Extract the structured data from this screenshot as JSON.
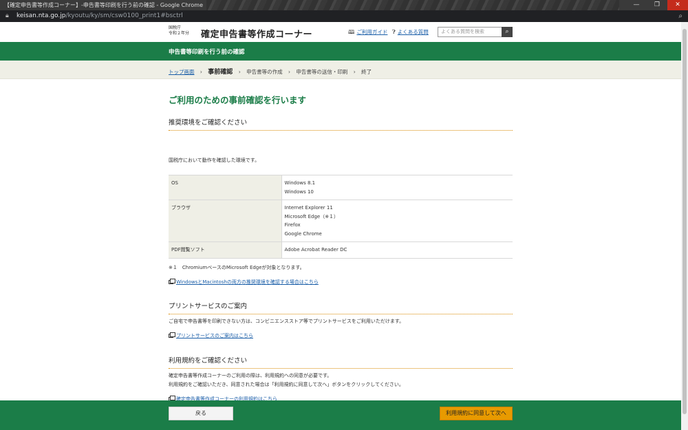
{
  "browser": {
    "window_title": "【確定申告書等作成コーナー】-申告書等印刷を行う前の確認 - Google Chrome",
    "url_host": "keisan.nta.go.jp",
    "url_path": "/kyoutu/ky/sm/csw0100_print1#bsctrl",
    "minimize": "—",
    "restore": "❐",
    "close": "✕"
  },
  "header": {
    "agency": "国税庁",
    "year": "令和２年分",
    "title": "確定申告書等作成コーナー",
    "guide_link": "ご利用ガイド",
    "faq_link": "よくある質問",
    "search_placeholder": "よくある質問を検索"
  },
  "green_bar": {
    "label": "申告書等印刷を行う前の確認"
  },
  "breadcrumb": {
    "items": [
      "トップ画面",
      "事前確認",
      "申告書等の作成",
      "申告書等の送信・印刷",
      "終了"
    ],
    "separator": "›"
  },
  "main": {
    "page_title": "ご利用のための事前確認を行います",
    "section1": {
      "heading": "推奨環境をご確認ください",
      "intro": "国税庁において動作を確認した環境です。",
      "table": [
        {
          "key": "OS",
          "values": [
            "Windows 8.1",
            "Windows 10"
          ]
        },
        {
          "key": "ブラウザ",
          "values": [
            "Internet Explorer 11",
            "Microsoft Edge（※１）",
            "Firefox",
            "Google Chrome"
          ]
        },
        {
          "key": "PDF閲覧ソフト",
          "values": [
            "Adobe Acrobat Reader DC"
          ]
        }
      ],
      "note": "※１　ChromiumベースのMicrosoft Edgeが対象となります。",
      "link": "WindowsとMacintoshの両方の推奨環境を確認する場合はこちら"
    },
    "section2": {
      "heading": "プリントサービスのご案内",
      "text": "ご自宅で申告書等を印刷できない方は、コンビニエンスストア等でプリントサービスをご利用いただけます。",
      "link": "プリントサービスのご案内はこちら"
    },
    "section3": {
      "heading": "利用規約をご確認ください",
      "text1": "確定申告書等作成コーナーのご利用の際は、利用規約への同意が必要です。",
      "text2": "利用規約をご確認いただき、同意された場合は「利用規約に同意して次へ」ボタンをクリックしてください。",
      "link": "確定申告書等作成コーナーの利用規約はこちら"
    }
  },
  "footer": {
    "back_label": "戻る",
    "next_label": "利用規約に同意して次へ"
  },
  "colors": {
    "brand_green": "#1b7d48",
    "accent_orange": "#e89a00",
    "link_blue": "#1a5ea8"
  }
}
